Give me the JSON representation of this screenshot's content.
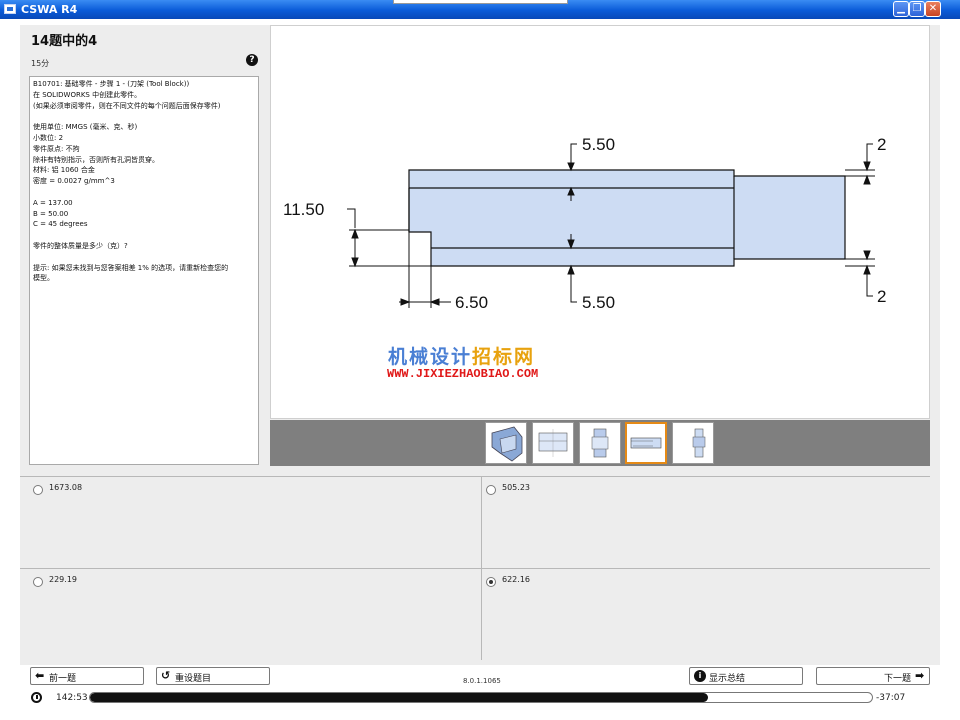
{
  "window": {
    "title": "CSWA R4",
    "minimize_icon": "minimize-icon",
    "restore_icon": "restore-icon",
    "close_icon": "close-icon"
  },
  "question": {
    "title": "14题中的4",
    "points": "15分",
    "help_icon": "?",
    "lines": [
      "B10701: 基础零件 - 步骤 1 - (刀架 (Tool Block))",
      "在 SOLIDWORKS 中创建此零件。",
      "(如果必须审阅零件，则在不同文件的每个问题后面保存零件)",
      "",
      "使用单位: MMGS (毫米、克、秒)",
      "小数位: 2",
      "零件原点: 不拘",
      "除非有特别指示，否则所有孔洞皆贯穿。",
      "材料: 铝 1060 合金",
      "密度 = 0.0027 g/mm^3",
      "",
      "A = 137.00",
      "B = 50.00",
      "C = 45 degrees",
      "",
      "零件的整体质量是多少（克）?",
      "",
      "提示: 如果您未找到与您答案相差 1% 的选项，请重新检查您的",
      "模型。"
    ]
  },
  "drawing": {
    "dimensions": {
      "top_step": "5.50",
      "right_top": "2",
      "left_height": "11.50",
      "bottom_step_width": "6.50",
      "bottom_step": "5.50",
      "right_bottom": "2"
    },
    "watermark": {
      "cn_part1": "机械设计",
      "cn_part2": "招标网",
      "url": "WWW.JIXIEZHAOBIAO.COM"
    },
    "thumbnails": [
      {
        "name": "thumbnail-1",
        "selected": false
      },
      {
        "name": "thumbnail-2",
        "selected": false
      },
      {
        "name": "thumbnail-3",
        "selected": false
      },
      {
        "name": "thumbnail-4",
        "selected": true
      },
      {
        "name": "thumbnail-5",
        "selected": false
      }
    ]
  },
  "answers": [
    {
      "value": "1673.08",
      "selected": false
    },
    {
      "value": "505.23",
      "selected": false
    },
    {
      "value": "229.19",
      "selected": false
    },
    {
      "value": "622.16",
      "selected": true
    }
  ],
  "footer": {
    "prev_label": "前一题",
    "reset_label": "重设题目",
    "version": "8.0.1.1065",
    "summary_label": "显示总结",
    "next_label": "下一题",
    "elapsed": "142:53",
    "remaining": "-37:07",
    "progress_fraction": 0.79
  },
  "colors": {
    "part_fill": "#CDDCF3",
    "accent_orange": "#E58A16",
    "titlebar_blue": "#0A5BD8"
  }
}
